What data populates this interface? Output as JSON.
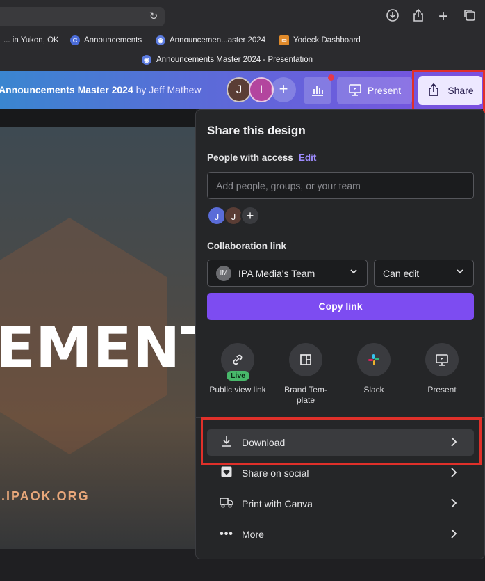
{
  "browser": {
    "bookmarks": [
      {
        "label": "... in Yukon, OK",
        "icon": "page-icon"
      },
      {
        "label": "Announcements",
        "icon": "canva-icon"
      },
      {
        "label": "Announcemen...aster 2024",
        "icon": "canva-doc-icon"
      },
      {
        "label": "Yodeck Dashboard",
        "icon": "yodeck-icon"
      }
    ],
    "tab_title": "Announcements Master 2024 - Presentation"
  },
  "header": {
    "doc_title": "Announcements Master 2024",
    "by_text": "by Jeff Mathew",
    "avatars": [
      "J",
      "I"
    ],
    "present_label": "Present",
    "share_label": "Share"
  },
  "slide": {
    "headline_fragment": "EMENT",
    "url_fragment": ".IPAOK.ORG"
  },
  "share_panel": {
    "title": "Share this design",
    "people_label": "People with access",
    "edit_label": "Edit",
    "input_placeholder": "Add people, groups, or your team",
    "people_avatars": [
      "J",
      "J"
    ],
    "collab_label": "Collaboration link",
    "team_initials": "IM",
    "team_select": "IPA Media's Team",
    "permission_select": "Can edit",
    "copy_link_label": "Copy link",
    "options": [
      {
        "label": "Public view link",
        "badge": "Live",
        "icon": "link-icon"
      },
      {
        "label": "Brand Tem-plate",
        "icon": "template-icon"
      },
      {
        "label": "Slack",
        "icon": "slack-icon"
      },
      {
        "label": "Present",
        "icon": "present-icon"
      }
    ],
    "rows": [
      {
        "label": "Download",
        "icon": "download-icon"
      },
      {
        "label": "Share on social",
        "icon": "heart-icon"
      },
      {
        "label": "Print with Canva",
        "icon": "truck-icon"
      },
      {
        "label": "More",
        "icon": "more-icon"
      }
    ]
  },
  "colors": {
    "accent": "#7d4cf1",
    "highlight": "#e0302a",
    "live_badge": "#48b86a"
  }
}
